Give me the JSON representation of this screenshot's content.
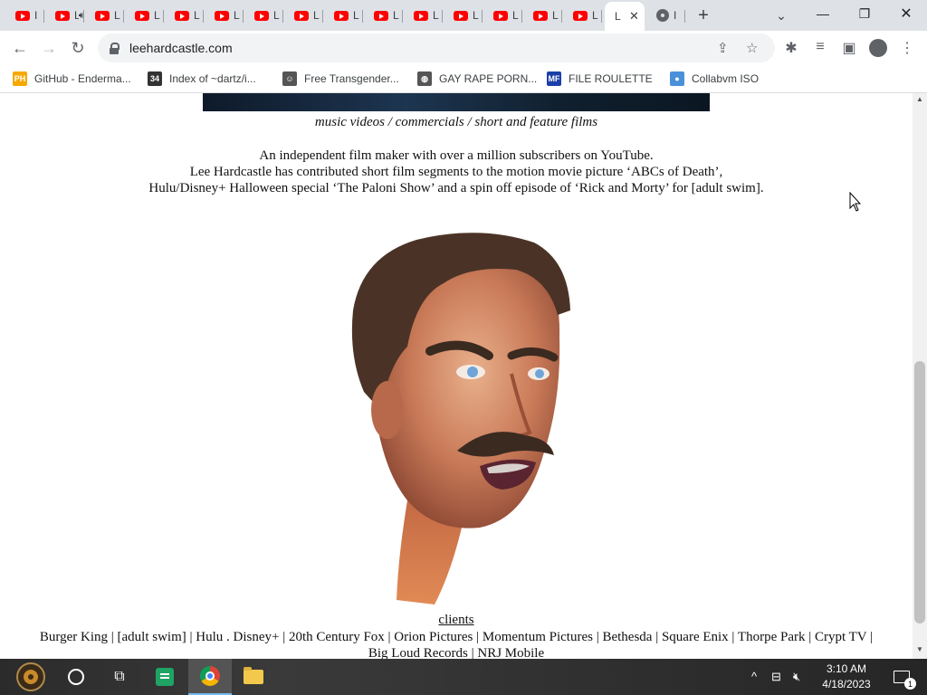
{
  "browser": {
    "tabs": [
      {
        "title": "I",
        "icon": "youtube-icon"
      },
      {
        "title": "L",
        "icon": "audio-icon"
      },
      {
        "title": "L",
        "icon": "youtube-icon"
      },
      {
        "title": "L",
        "icon": "youtube-icon"
      },
      {
        "title": "L",
        "icon": "youtube-icon"
      },
      {
        "title": "L",
        "icon": "youtube-icon"
      },
      {
        "title": "L",
        "icon": "youtube-icon"
      },
      {
        "title": "L",
        "icon": "youtube-icon"
      },
      {
        "title": "L",
        "icon": "youtube-icon"
      },
      {
        "title": "L",
        "icon": "youtube-icon"
      },
      {
        "title": "L",
        "icon": "youtube-icon"
      },
      {
        "title": "L",
        "icon": "youtube-icon"
      },
      {
        "title": "L",
        "icon": "youtube-icon"
      },
      {
        "title": "L",
        "icon": "youtube-icon"
      },
      {
        "title": "L",
        "icon": "youtube-icon"
      },
      {
        "title": "L",
        "icon": "none",
        "active": true
      },
      {
        "title": "I",
        "icon": "chrome-icon"
      }
    ],
    "active_tab_close": "✕",
    "new_tab": "+",
    "url": "leehardcastle.com"
  },
  "bookmarks": [
    {
      "label": "GitHub - Enderma...",
      "icon": "PH",
      "color": "#f7a800"
    },
    {
      "label": "Index of ~dartz/i...",
      "icon": "34",
      "color": "#333333"
    },
    {
      "label": "Free Transgender...",
      "icon": "☺",
      "color": "#555555"
    },
    {
      "label": "GAY RAPE PORN...",
      "icon": "◍",
      "color": "#555555"
    },
    {
      "label": "FILE ROULETTE",
      "icon": "MF",
      "color": "#1a3fa8"
    },
    {
      "label": "Collabvm ISO",
      "icon": "●",
      "color": "#4a90d9"
    }
  ],
  "page": {
    "tagline": "music videos / commercials / short and feature films",
    "bio_lines": [
      "An independent film maker with over a million subscribers on YouTube.",
      "Lee Hardcastle has contributed short film segments to the motion movie picture ‘ABCs of Death’,",
      "Hulu/Disney+ Halloween special ‘The Paloni Show’ and a spin off episode of ‘Rick and Morty’ for [adult swim]."
    ],
    "clients_title": "clients",
    "clients_line1": "Burger King | [adult swim] | Hulu . Disney+ | 20th Century Fox | Orion Pictures | Momentum Pictures | Bethesda | Square Enix | Thorpe Park | Crypt TV |",
    "clients_line2": "Big Loud Records | NRJ Mobile"
  },
  "taskbar": {
    "time": "3:10 AM",
    "date": "4/18/2023",
    "notification_count": "1"
  }
}
